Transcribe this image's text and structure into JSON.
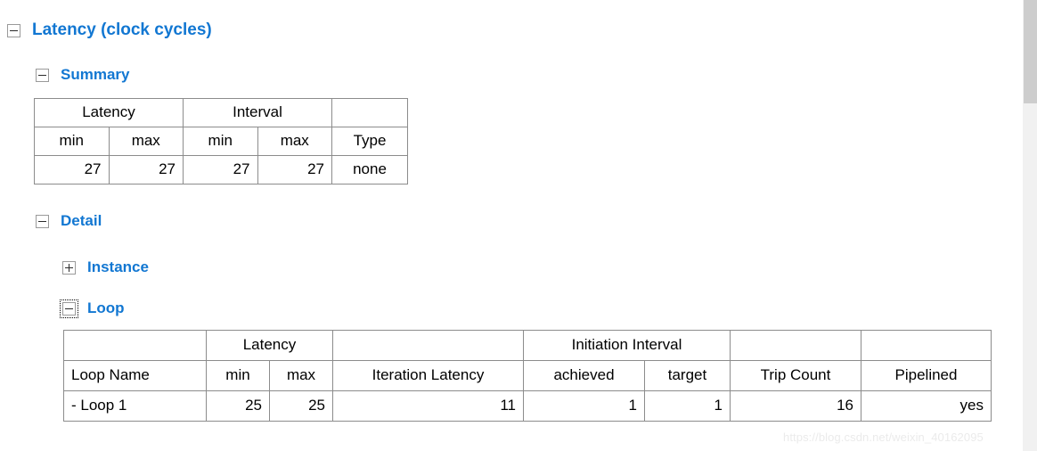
{
  "tree": {
    "latency": {
      "label": "Latency (clock cycles)",
      "state": "expanded",
      "icon": "minus-expander-icon"
    },
    "summary": {
      "label": "Summary",
      "state": "expanded",
      "icon": "minus-expander-icon"
    },
    "detail": {
      "label": "Detail",
      "state": "expanded",
      "icon": "minus-expander-icon"
    },
    "instance": {
      "label": "Instance",
      "state": "collapsed",
      "icon": "plus-expander-icon"
    },
    "loop": {
      "label": "Loop",
      "state": "expanded",
      "icon": "minus-expander-icon",
      "focused": true
    }
  },
  "summary_table": {
    "group_headers": {
      "latency": "Latency",
      "interval": "Interval",
      "type": ""
    },
    "sub_headers": {
      "latency_min": "min",
      "latency_max": "max",
      "interval_min": "min",
      "interval_max": "max",
      "type": "Type"
    },
    "row": {
      "latency_min": "27",
      "latency_max": "27",
      "interval_min": "27",
      "interval_max": "27",
      "type": "none"
    }
  },
  "loop_table": {
    "group_headers": {
      "name": "",
      "latency": "Latency",
      "iteration_latency": "",
      "initiation_interval": "Initiation Interval",
      "trip_count": "",
      "pipelined": ""
    },
    "sub_headers": {
      "name": "Loop Name",
      "latency_min": "min",
      "latency_max": "max",
      "iteration_latency": "Iteration Latency",
      "ii_achieved": "achieved",
      "ii_target": "target",
      "trip_count": "Trip Count",
      "pipelined": "Pipelined"
    },
    "rows": [
      {
        "name": "- Loop 1",
        "latency_min": "25",
        "latency_max": "25",
        "iteration_latency": "11",
        "ii_achieved": "1",
        "ii_target": "1",
        "trip_count": "16",
        "pipelined": "yes"
      }
    ]
  },
  "watermark": {
    "text": "https://blog.csdn.net/weixin_40162095"
  },
  "colors": {
    "heading_blue": "#1277d2",
    "border_gray": "#8c8c8c",
    "scrollbar_thumb": "#cdcdcd"
  }
}
